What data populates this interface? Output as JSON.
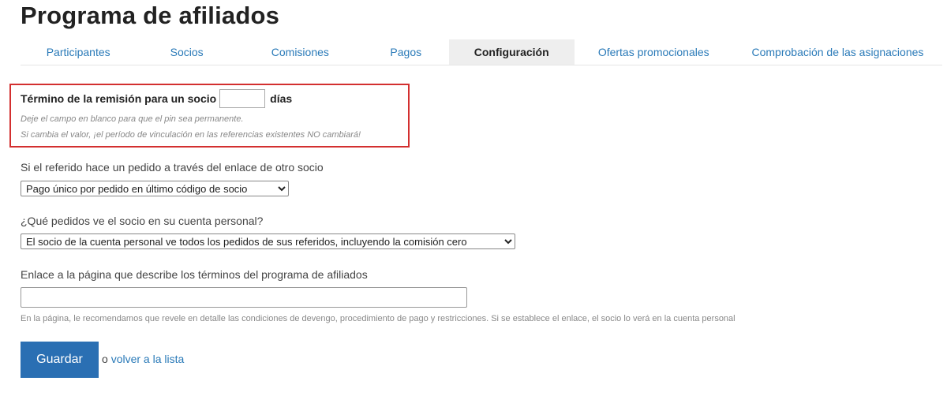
{
  "page": {
    "title": "Programa de afiliados"
  },
  "tabs": [
    {
      "label": "Participantes",
      "active": false
    },
    {
      "label": "Socios",
      "active": false
    },
    {
      "label": "Comisiones",
      "active": false
    },
    {
      "label": "Pagos",
      "active": false
    },
    {
      "label": "Configuración",
      "active": true
    },
    {
      "label": "Ofertas promocionales",
      "active": false
    },
    {
      "label": "Comprobación de las asignaciones",
      "active": false
    }
  ],
  "referral_term": {
    "label": "Término de la remisión para un socio",
    "value": "",
    "unit": "días",
    "hint_1": "Deje el campo en blanco para que el pin sea permanente.",
    "hint_2": "Si cambia el valor, ¡el período de vinculación en las referencias existentes NO cambiará!"
  },
  "other_partner_link": {
    "label": "Si el referido hace un pedido a través del enlace de otro socio",
    "selected": "Pago único por pedido en último código de socio"
  },
  "orders_visibility": {
    "label": "¿Qué pedidos ve el socio en su cuenta personal?",
    "selected": "El socio de la cuenta personal ve todos los pedidos de sus referidos, incluyendo la comisión cero"
  },
  "terms_link": {
    "label": "Enlace a la página que describe los términos del programa de afiliados",
    "value": "",
    "help": "En la página, le recomendamos que revele en detalle las condiciones de devengo, procedimiento de pago y restricciones. Si se establece el enlace, el socio lo verá en la cuenta personal"
  },
  "actions": {
    "save_label": "Guardar",
    "or_text": "o ",
    "back_link": "volver a la lista"
  },
  "colors": {
    "accent": "#2a6fb3",
    "link": "#2a7ab8",
    "highlight_border": "#d32f2f"
  }
}
